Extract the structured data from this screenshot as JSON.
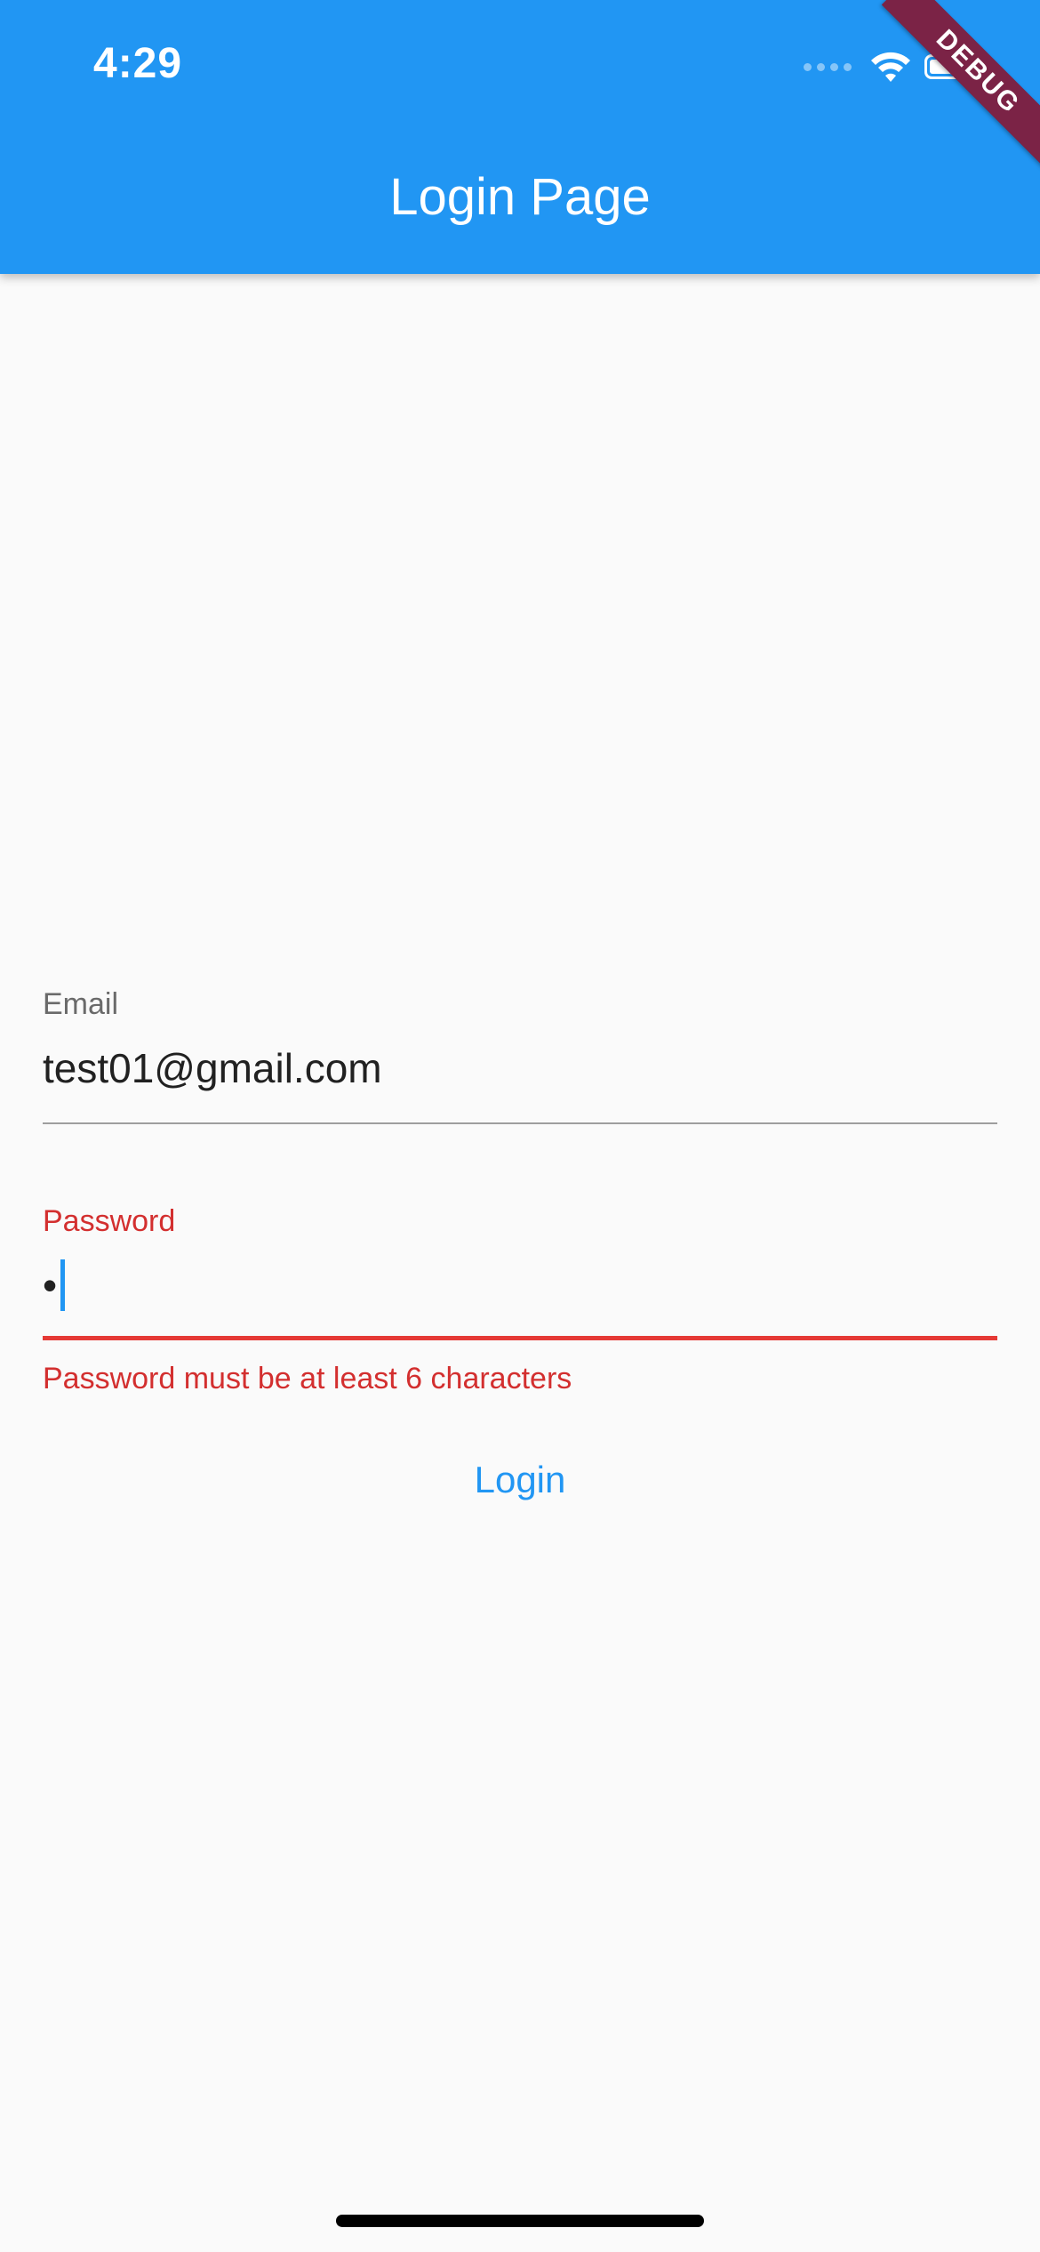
{
  "status_bar": {
    "time": "4:29"
  },
  "app_bar": {
    "title": "Login Page"
  },
  "debug_banner": {
    "label": "DEBUG"
  },
  "form": {
    "email": {
      "label": "Email",
      "value": "test01@gmail.com"
    },
    "password": {
      "label": "Password",
      "masked_value": "•",
      "error": "Password must be at least 6 characters"
    }
  },
  "actions": {
    "login_label": "Login"
  },
  "colors": {
    "primary": "#2196f3",
    "error": "#d32f2f",
    "debug_banner": "#7b2346",
    "background": "#fafafa"
  },
  "icons": [
    "wifi-icon",
    "battery-icon",
    "cellular-signal-icon"
  ]
}
